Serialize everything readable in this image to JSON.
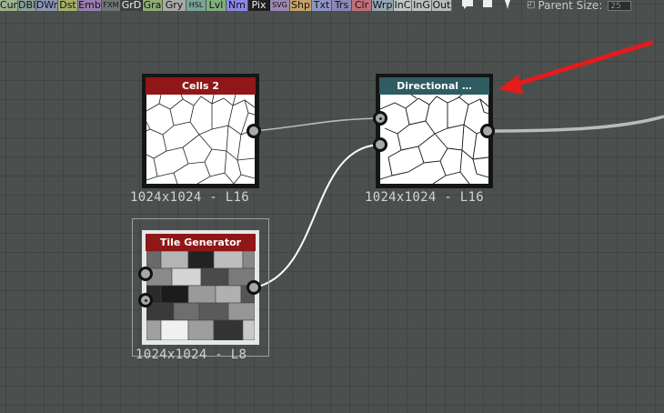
{
  "toolbar": {
    "buttons": [
      {
        "label": "Cur",
        "color": "#9eb28c"
      },
      {
        "label": "DBl",
        "color": "#8ba09a"
      },
      {
        "label": "DWr",
        "color": "#8a97b5"
      },
      {
        "label": "Dst",
        "color": "#a7b06a"
      },
      {
        "label": "Emb",
        "color": "#9a7fb0"
      },
      {
        "label": "FXM",
        "color": "#6e7676"
      },
      {
        "label": "GrD",
        "color": "#3c3f3f"
      },
      {
        "label": "Gra",
        "color": "#8fae74"
      },
      {
        "label": "Gry",
        "color": "#a8aaa9"
      },
      {
        "label": "HSL",
        "color": "#7aa39a"
      },
      {
        "label": "Lvl",
        "color": "#7fb07b"
      },
      {
        "label": "Nm",
        "color": "#8c87e6"
      },
      {
        "label": "Pix",
        "color": "#1f1f1f"
      },
      {
        "label": "SVG",
        "color": "#9a88b5"
      },
      {
        "label": "Shp",
        "color": "#c7a368"
      },
      {
        "label": "Txt",
        "color": "#8f96c4"
      },
      {
        "label": "Trs",
        "color": "#8d86b8"
      },
      {
        "label": "Clr",
        "color": "#c26f7a"
      },
      {
        "label": "Wrp",
        "color": "#95a7b5"
      },
      {
        "label": "InC",
        "color": "#c3c4c4"
      },
      {
        "label": "InG",
        "color": "#bfc0c0"
      },
      {
        "label": "Out",
        "color": "#b9baba"
      }
    ],
    "parent_size_label": "Parent Size:",
    "parent_size_value": "25"
  },
  "nodes": {
    "cells": {
      "title": "Cells 2",
      "resolution": "1024x1024 - L16",
      "header_color": "#8f1717"
    },
    "directional": {
      "title": "Directional …",
      "resolution": "1024x1024 - L16",
      "header_color": "#2e5c62"
    },
    "tile_generator": {
      "title": "Tile Generator",
      "resolution": "1024x1024 - L8",
      "header_color": "#8f1717"
    }
  },
  "annotation": {
    "arrow_color": "#e41b1b"
  },
  "icons": [
    "comment-icon",
    "frame-icon",
    "pin-icon",
    "parent-size-icon"
  ]
}
